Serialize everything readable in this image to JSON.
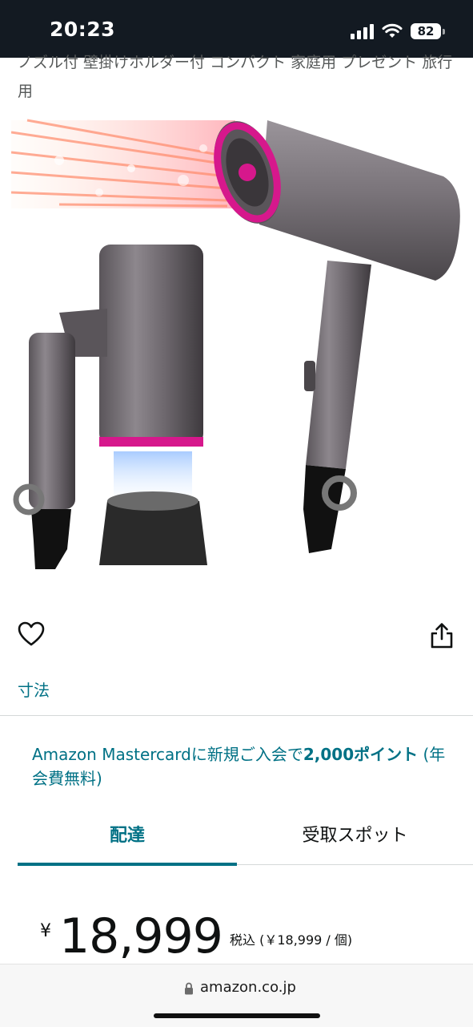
{
  "status_bar": {
    "time": "20:23",
    "battery": "82"
  },
  "title_snippet": "ノズル付 壁掛けホルダー付 コンパクト 家庭用 プレゼント 旅行用",
  "actions": {
    "wishlist_icon": "heart-icon",
    "share_icon": "share-icon"
  },
  "size_link": "寸法",
  "promo": {
    "prefix": "Amazon Mastercardに新規ご入会で",
    "points": "2,000ポイント",
    "suffix": " (年会費無料)"
  },
  "tabs": [
    {
      "label": "配達",
      "active": true
    },
    {
      "label": "受取スポット",
      "active": false
    }
  ],
  "price": {
    "currency": "¥",
    "amount": "18,999",
    "tax_note": "税込 (￥18,999 / 個)"
  },
  "browser": {
    "url": "amazon.co.jp"
  },
  "colors": {
    "link": "#007185",
    "accent_magenta": "#d6188c",
    "status_bar": "#131a22"
  }
}
